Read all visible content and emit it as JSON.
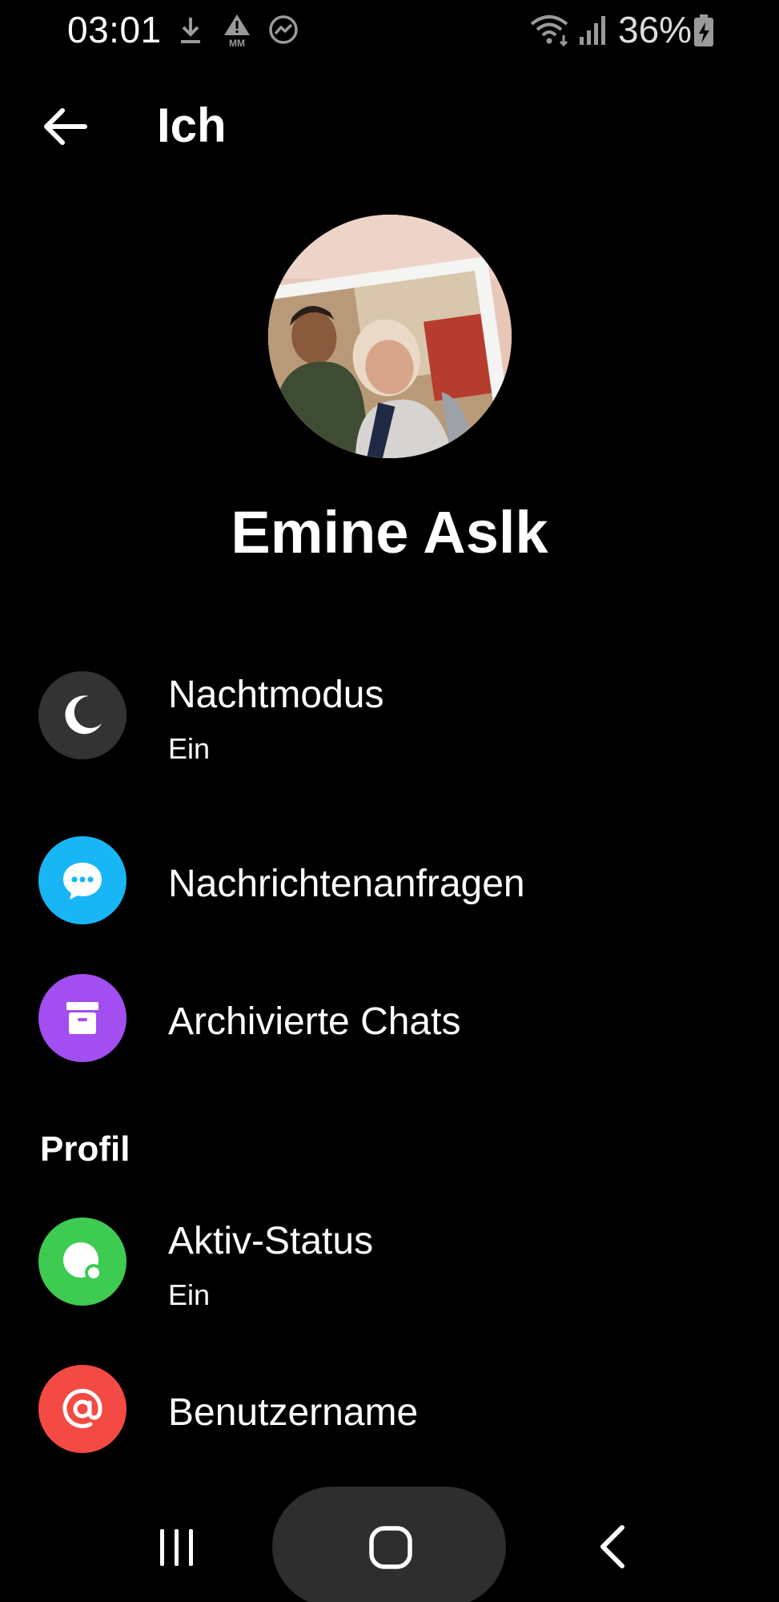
{
  "status_bar": {
    "time": "03:01",
    "battery_percent": "36%",
    "icons": [
      "download-icon",
      "alert-mm-icon",
      "messenger-icon",
      "wifi-icon",
      "signal-icon",
      "battery-charging-icon"
    ]
  },
  "header": {
    "title": "Ich",
    "back_icon": "arrow-left-icon"
  },
  "profile": {
    "name": "Emine Aslk",
    "avatar": "profile-photo"
  },
  "menu": {
    "items": [
      {
        "label": "Nachtmodus",
        "sublabel": "Ein",
        "icon": "moon-icon",
        "color": "#333333"
      },
      {
        "label": "Nachrichtenanfragen",
        "icon": "chat-bubble-icon",
        "color": "#19b6f5"
      },
      {
        "label": "Archivierte Chats",
        "icon": "archive-box-icon",
        "color": "#a24ef0"
      }
    ]
  },
  "profile_section": {
    "title": "Profil",
    "items": [
      {
        "label": "Aktiv-Status",
        "sublabel": "Ein",
        "icon": "active-status-icon",
        "color": "#3ecb52"
      },
      {
        "label": "Benutzername",
        "icon": "at-sign-icon",
        "color": "#f44a44"
      }
    ]
  },
  "nav_bar": {
    "icons": [
      "recents-icon",
      "home-icon",
      "back-icon"
    ]
  }
}
